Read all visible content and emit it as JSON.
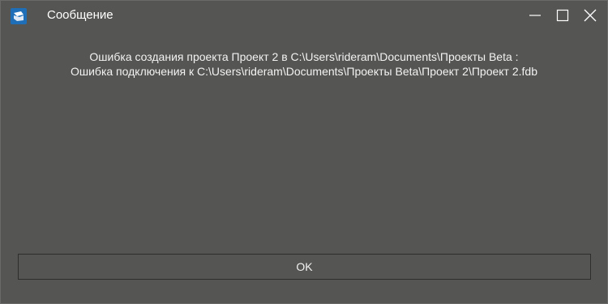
{
  "window": {
    "title": "Сообщение",
    "icon": "app-logo-icon",
    "controls": [
      "minimize-icon",
      "maximize-icon",
      "close-icon"
    ]
  },
  "message": {
    "line1": "Ошибка создания проекта Проект 2 в C:\\Users\\rideram\\Documents\\Проекты Beta :",
    "line2": "Ошибка подключения к C:\\Users\\rideram\\Documents\\Проекты Beta\\Проект 2\\Проект 2.fdb"
  },
  "buttons": {
    "ok_label": "OK"
  },
  "colors": {
    "background": "#555553",
    "text": "#f2f2f2",
    "icon_accent": "#1e6fb8"
  }
}
